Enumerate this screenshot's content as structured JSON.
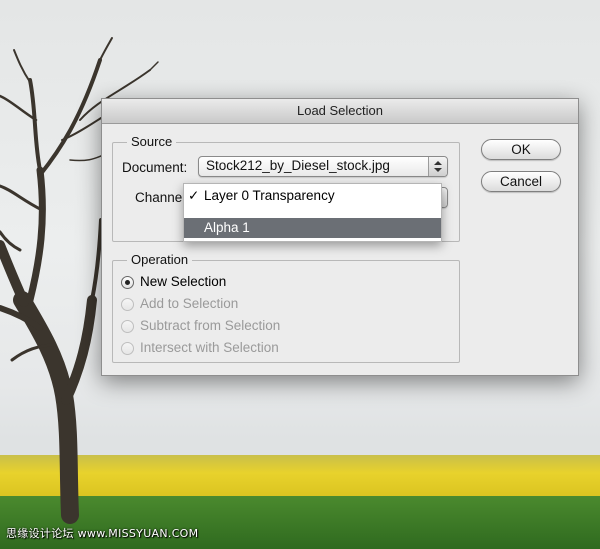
{
  "dialog": {
    "title": "Load Selection",
    "source": {
      "legend": "Source",
      "document_label": "Document:",
      "document_value": "Stock212_by_Diesel_stock.jpg",
      "channel_label": "Channel"
    },
    "channel_menu": {
      "items": [
        {
          "label": "Layer 0 Transparency",
          "checked": true
        },
        {
          "label": "Alpha 1",
          "highlighted": true
        }
      ],
      "checkmark": "✓"
    },
    "operation": {
      "legend": "Operation",
      "options": [
        {
          "label": "New Selection",
          "selected": true,
          "enabled": true
        },
        {
          "label": "Add to Selection",
          "selected": false,
          "enabled": false
        },
        {
          "label": "Subtract from Selection",
          "selected": false,
          "enabled": false
        },
        {
          "label": "Intersect with Selection",
          "selected": false,
          "enabled": false
        }
      ]
    },
    "buttons": {
      "ok": "OK",
      "cancel": "Cancel"
    }
  },
  "watermark": "思缘设计论坛 www.MISSYUAN.COM",
  "colors": {
    "menu_highlight": "#6b6f75",
    "field_yellow": "#e8d22c",
    "grass": "#3f7d2a"
  }
}
